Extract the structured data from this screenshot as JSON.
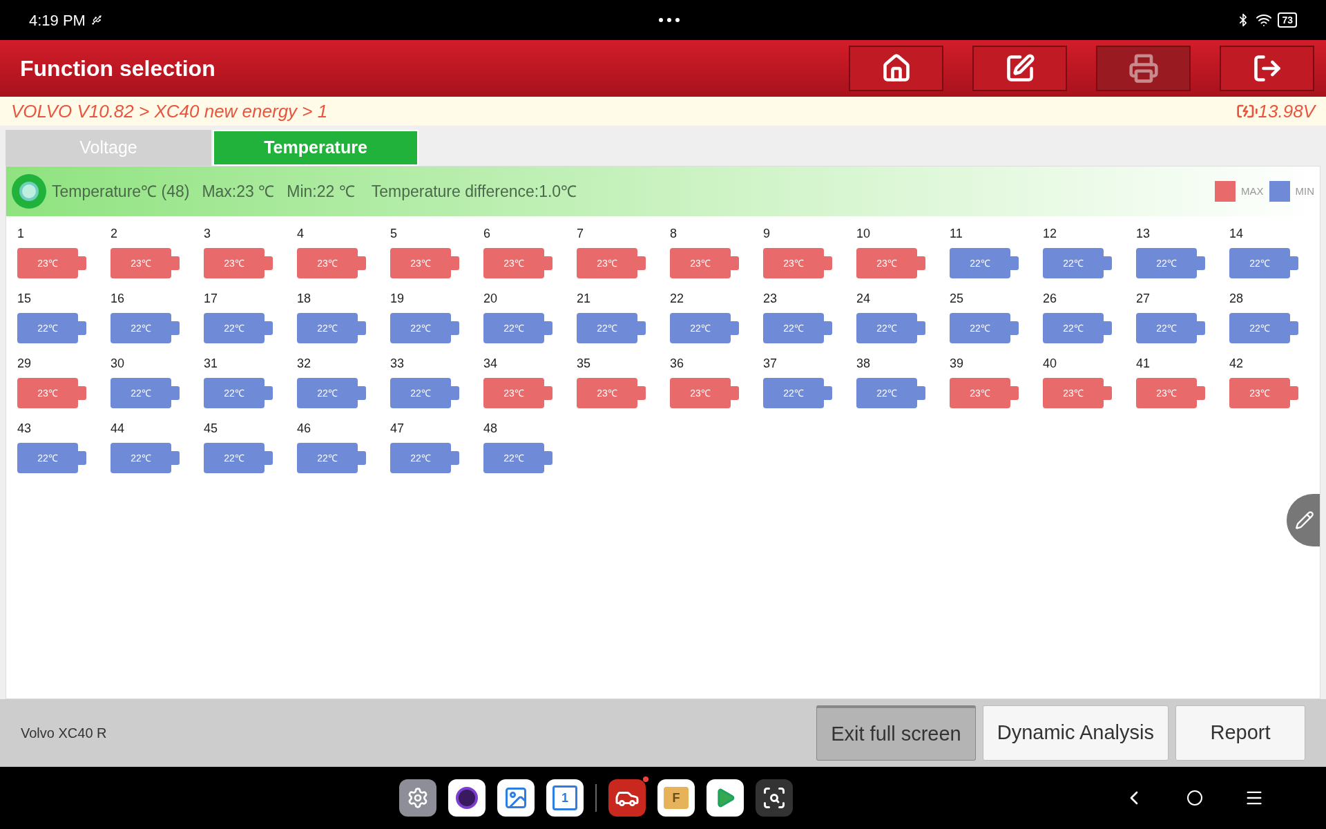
{
  "status_bar": {
    "time": "4:19 PM",
    "battery": "73"
  },
  "header": {
    "title": "Function selection",
    "buttons": [
      {
        "kind": "home",
        "disabled": false
      },
      {
        "kind": "edit",
        "disabled": false
      },
      {
        "kind": "print",
        "disabled": true
      },
      {
        "kind": "exit",
        "disabled": false
      }
    ]
  },
  "breadcrumb": {
    "path": "VOLVO V10.82 > XC40 new energy  > 1",
    "voltage": "13.98V"
  },
  "tabs": [
    {
      "label": "Voltage",
      "selected": false
    },
    {
      "label": "Temperature",
      "selected": true
    }
  ],
  "summary": {
    "title": "Temperature℃ (48)",
    "max": "Max:23 ℃",
    "min": "Min:22 ℃",
    "difference": "Temperature difference:1.0℃",
    "legend": [
      {
        "label": "MAX",
        "color": "#e96a6a"
      },
      {
        "label": "MIN",
        "color": "#6f8bd8"
      }
    ]
  },
  "cells": [
    {
      "label": "1",
      "reading": "23℃",
      "color": "#e96a6a"
    },
    {
      "label": "2",
      "reading": "23℃",
      "color": "#e96a6a"
    },
    {
      "label": "3",
      "reading": "23℃",
      "color": "#e96a6a"
    },
    {
      "label": "4",
      "reading": "23℃",
      "color": "#e96a6a"
    },
    {
      "label": "5",
      "reading": "23℃",
      "color": "#e96a6a"
    },
    {
      "label": "6",
      "reading": "23℃",
      "color": "#e96a6a"
    },
    {
      "label": "7",
      "reading": "23℃",
      "color": "#e96a6a"
    },
    {
      "label": "8",
      "reading": "23℃",
      "color": "#e96a6a"
    },
    {
      "label": "9",
      "reading": "23℃",
      "color": "#e96a6a"
    },
    {
      "label": "10",
      "reading": "23℃",
      "color": "#e96a6a"
    },
    {
      "label": "11",
      "reading": "22℃",
      "color": "#6f8bd8"
    },
    {
      "label": "12",
      "reading": "22℃",
      "color": "#6f8bd8"
    },
    {
      "label": "13",
      "reading": "22℃",
      "color": "#6f8bd8"
    },
    {
      "label": "14",
      "reading": "22℃",
      "color": "#6f8bd8"
    },
    {
      "label": "15",
      "reading": "22℃",
      "color": "#6f8bd8"
    },
    {
      "label": "16",
      "reading": "22℃",
      "color": "#6f8bd8"
    },
    {
      "label": "17",
      "reading": "22℃",
      "color": "#6f8bd8"
    },
    {
      "label": "18",
      "reading": "22℃",
      "color": "#6f8bd8"
    },
    {
      "label": "19",
      "reading": "22℃",
      "color": "#6f8bd8"
    },
    {
      "label": "20",
      "reading": "22℃",
      "color": "#6f8bd8"
    },
    {
      "label": "21",
      "reading": "22℃",
      "color": "#6f8bd8"
    },
    {
      "label": "22",
      "reading": "22℃",
      "color": "#6f8bd8"
    },
    {
      "label": "23",
      "reading": "22℃",
      "color": "#6f8bd8"
    },
    {
      "label": "24",
      "reading": "22℃",
      "color": "#6f8bd8"
    },
    {
      "label": "25",
      "reading": "22℃",
      "color": "#6f8bd8"
    },
    {
      "label": "26",
      "reading": "22℃",
      "color": "#6f8bd8"
    },
    {
      "label": "27",
      "reading": "22℃",
      "color": "#6f8bd8"
    },
    {
      "label": "28",
      "reading": "22℃",
      "color": "#6f8bd8"
    },
    {
      "label": "29",
      "reading": "23℃",
      "color": "#e96a6a"
    },
    {
      "label": "30",
      "reading": "22℃",
      "color": "#6f8bd8"
    },
    {
      "label": "31",
      "reading": "22℃",
      "color": "#6f8bd8"
    },
    {
      "label": "32",
      "reading": "22℃",
      "color": "#6f8bd8"
    },
    {
      "label": "33",
      "reading": "22℃",
      "color": "#6f8bd8"
    },
    {
      "label": "34",
      "reading": "23℃",
      "color": "#e96a6a"
    },
    {
      "label": "35",
      "reading": "23℃",
      "color": "#e96a6a"
    },
    {
      "label": "36",
      "reading": "23℃",
      "color": "#e96a6a"
    },
    {
      "label": "37",
      "reading": "22℃",
      "color": "#6f8bd8"
    },
    {
      "label": "38",
      "reading": "22℃",
      "color": "#6f8bd8"
    },
    {
      "label": "39",
      "reading": "23℃",
      "color": "#e96a6a"
    },
    {
      "label": "40",
      "reading": "23℃",
      "color": "#e96a6a"
    },
    {
      "label": "41",
      "reading": "23℃",
      "color": "#e96a6a"
    },
    {
      "label": "42",
      "reading": "23℃",
      "color": "#e96a6a"
    },
    {
      "label": "43",
      "reading": "22℃",
      "color": "#6f8bd8"
    },
    {
      "label": "44",
      "reading": "22℃",
      "color": "#6f8bd8"
    },
    {
      "label": "45",
      "reading": "22℃",
      "color": "#6f8bd8"
    },
    {
      "label": "46",
      "reading": "22℃",
      "color": "#6f8bd8"
    },
    {
      "label": "47",
      "reading": "22℃",
      "color": "#6f8bd8"
    },
    {
      "label": "48",
      "reading": "22℃",
      "color": "#6f8bd8"
    }
  ],
  "footer": {
    "vehicle": "Volvo XC40 R",
    "buttons": [
      {
        "label": "Exit full screen",
        "selected": true
      },
      {
        "label": "Dynamic Analysis",
        "selected": false
      },
      {
        "label": "Report",
        "selected": false
      }
    ]
  },
  "dock": [
    {
      "kind": "settings"
    },
    {
      "kind": "camera"
    },
    {
      "kind": "gallery"
    },
    {
      "kind": "calendar",
      "glyph": "1"
    },
    {
      "kind": "car"
    },
    {
      "kind": "files",
      "glyph": "F"
    },
    {
      "kind": "play"
    },
    {
      "kind": "scan"
    }
  ]
}
